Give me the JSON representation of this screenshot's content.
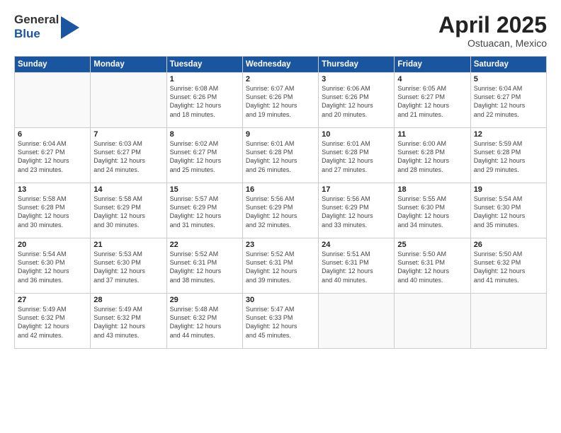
{
  "logo": {
    "general": "General",
    "blue": "Blue"
  },
  "title": {
    "month": "April 2025",
    "location": "Ostuacan, Mexico"
  },
  "weekdays": [
    "Sunday",
    "Monday",
    "Tuesday",
    "Wednesday",
    "Thursday",
    "Friday",
    "Saturday"
  ],
  "weeks": [
    [
      {
        "day": "",
        "info": ""
      },
      {
        "day": "",
        "info": ""
      },
      {
        "day": "1",
        "info": "Sunrise: 6:08 AM\nSunset: 6:26 PM\nDaylight: 12 hours\nand 18 minutes."
      },
      {
        "day": "2",
        "info": "Sunrise: 6:07 AM\nSunset: 6:26 PM\nDaylight: 12 hours\nand 19 minutes."
      },
      {
        "day": "3",
        "info": "Sunrise: 6:06 AM\nSunset: 6:26 PM\nDaylight: 12 hours\nand 20 minutes."
      },
      {
        "day": "4",
        "info": "Sunrise: 6:05 AM\nSunset: 6:27 PM\nDaylight: 12 hours\nand 21 minutes."
      },
      {
        "day": "5",
        "info": "Sunrise: 6:04 AM\nSunset: 6:27 PM\nDaylight: 12 hours\nand 22 minutes."
      }
    ],
    [
      {
        "day": "6",
        "info": "Sunrise: 6:04 AM\nSunset: 6:27 PM\nDaylight: 12 hours\nand 23 minutes."
      },
      {
        "day": "7",
        "info": "Sunrise: 6:03 AM\nSunset: 6:27 PM\nDaylight: 12 hours\nand 24 minutes."
      },
      {
        "day": "8",
        "info": "Sunrise: 6:02 AM\nSunset: 6:27 PM\nDaylight: 12 hours\nand 25 minutes."
      },
      {
        "day": "9",
        "info": "Sunrise: 6:01 AM\nSunset: 6:28 PM\nDaylight: 12 hours\nand 26 minutes."
      },
      {
        "day": "10",
        "info": "Sunrise: 6:01 AM\nSunset: 6:28 PM\nDaylight: 12 hours\nand 27 minutes."
      },
      {
        "day": "11",
        "info": "Sunrise: 6:00 AM\nSunset: 6:28 PM\nDaylight: 12 hours\nand 28 minutes."
      },
      {
        "day": "12",
        "info": "Sunrise: 5:59 AM\nSunset: 6:28 PM\nDaylight: 12 hours\nand 29 minutes."
      }
    ],
    [
      {
        "day": "13",
        "info": "Sunrise: 5:58 AM\nSunset: 6:28 PM\nDaylight: 12 hours\nand 30 minutes."
      },
      {
        "day": "14",
        "info": "Sunrise: 5:58 AM\nSunset: 6:29 PM\nDaylight: 12 hours\nand 30 minutes."
      },
      {
        "day": "15",
        "info": "Sunrise: 5:57 AM\nSunset: 6:29 PM\nDaylight: 12 hours\nand 31 minutes."
      },
      {
        "day": "16",
        "info": "Sunrise: 5:56 AM\nSunset: 6:29 PM\nDaylight: 12 hours\nand 32 minutes."
      },
      {
        "day": "17",
        "info": "Sunrise: 5:56 AM\nSunset: 6:29 PM\nDaylight: 12 hours\nand 33 minutes."
      },
      {
        "day": "18",
        "info": "Sunrise: 5:55 AM\nSunset: 6:30 PM\nDaylight: 12 hours\nand 34 minutes."
      },
      {
        "day": "19",
        "info": "Sunrise: 5:54 AM\nSunset: 6:30 PM\nDaylight: 12 hours\nand 35 minutes."
      }
    ],
    [
      {
        "day": "20",
        "info": "Sunrise: 5:54 AM\nSunset: 6:30 PM\nDaylight: 12 hours\nand 36 minutes."
      },
      {
        "day": "21",
        "info": "Sunrise: 5:53 AM\nSunset: 6:30 PM\nDaylight: 12 hours\nand 37 minutes."
      },
      {
        "day": "22",
        "info": "Sunrise: 5:52 AM\nSunset: 6:31 PM\nDaylight: 12 hours\nand 38 minutes."
      },
      {
        "day": "23",
        "info": "Sunrise: 5:52 AM\nSunset: 6:31 PM\nDaylight: 12 hours\nand 39 minutes."
      },
      {
        "day": "24",
        "info": "Sunrise: 5:51 AM\nSunset: 6:31 PM\nDaylight: 12 hours\nand 40 minutes."
      },
      {
        "day": "25",
        "info": "Sunrise: 5:50 AM\nSunset: 6:31 PM\nDaylight: 12 hours\nand 40 minutes."
      },
      {
        "day": "26",
        "info": "Sunrise: 5:50 AM\nSunset: 6:32 PM\nDaylight: 12 hours\nand 41 minutes."
      }
    ],
    [
      {
        "day": "27",
        "info": "Sunrise: 5:49 AM\nSunset: 6:32 PM\nDaylight: 12 hours\nand 42 minutes."
      },
      {
        "day": "28",
        "info": "Sunrise: 5:49 AM\nSunset: 6:32 PM\nDaylight: 12 hours\nand 43 minutes."
      },
      {
        "day": "29",
        "info": "Sunrise: 5:48 AM\nSunset: 6:32 PM\nDaylight: 12 hours\nand 44 minutes."
      },
      {
        "day": "30",
        "info": "Sunrise: 5:47 AM\nSunset: 6:33 PM\nDaylight: 12 hours\nand 45 minutes."
      },
      {
        "day": "",
        "info": ""
      },
      {
        "day": "",
        "info": ""
      },
      {
        "day": "",
        "info": ""
      }
    ]
  ]
}
